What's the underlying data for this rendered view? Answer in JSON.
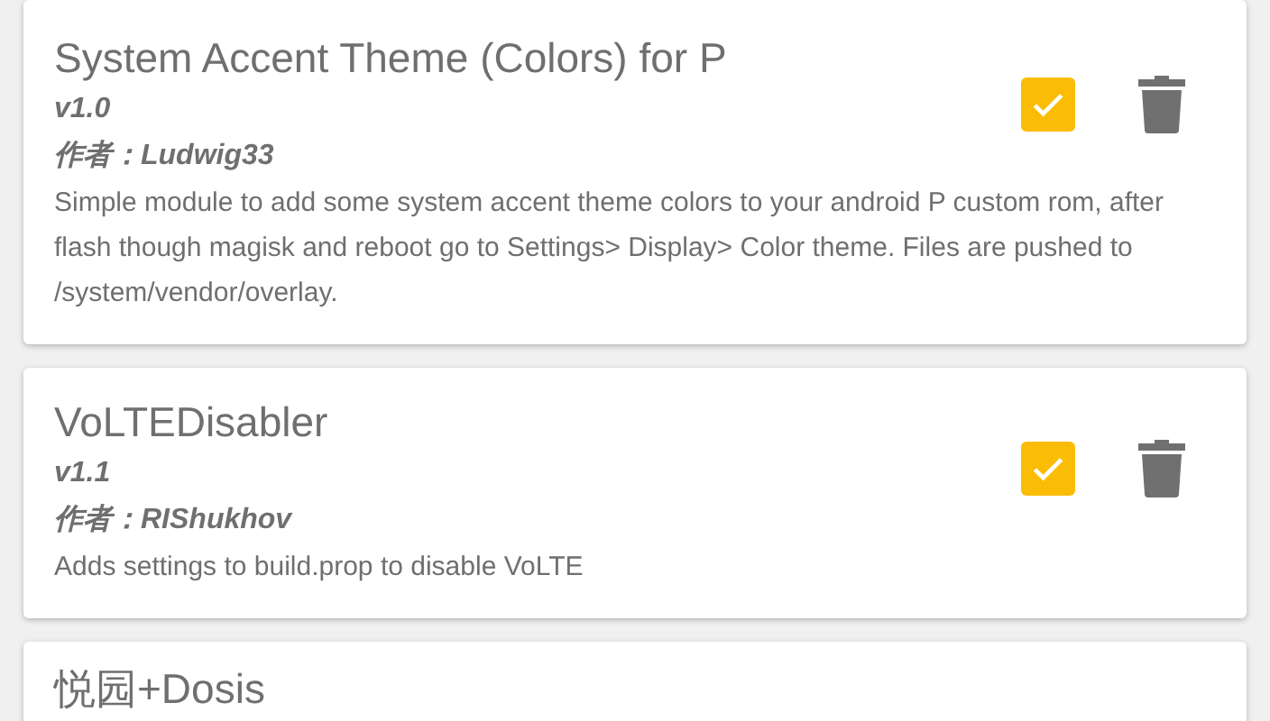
{
  "modules": [
    {
      "title": "System Accent Theme (Colors) for P",
      "version": "v1.0",
      "author": "作者：Ludwig33",
      "description": "Simple module to add some system accent theme colors to your android P custom rom, after flash though magisk and reboot go to Settings> Display> Color theme. Files are pushed to /system/vendor/overlay.",
      "enabled": true
    },
    {
      "title": "VoLTEDisabler",
      "version": "v1.1",
      "author": "作者：RIShukhov",
      "description": "Adds settings to build.prop to disable VoLTE",
      "enabled": true
    },
    {
      "title": "悦园+Dosis"
    }
  ]
}
